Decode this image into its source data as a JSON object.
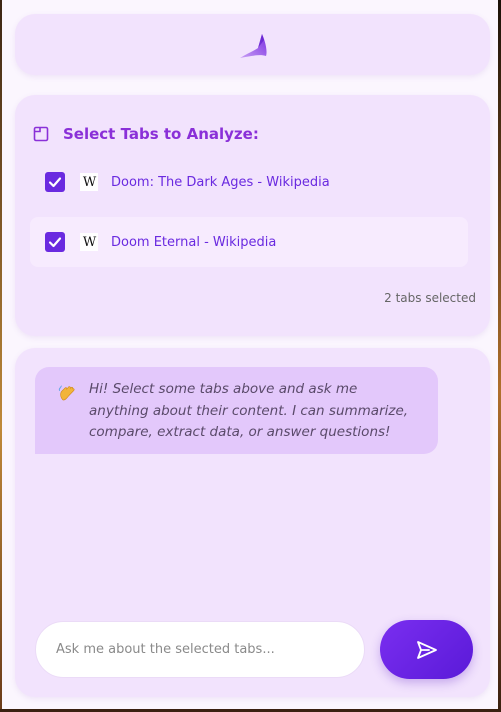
{
  "header": {
    "logo_icon": "megaphone-horn-icon"
  },
  "tabs_panel": {
    "title": "Select Tabs to Analyze:",
    "title_icon": "tab-icon",
    "tabs": [
      {
        "checked": true,
        "favicon": "W",
        "title": "Doom: The Dark Ages - Wikipedia"
      },
      {
        "checked": true,
        "favicon": "W",
        "title": "Doom Eternal - Wikipedia"
      }
    ],
    "selected_count_text": "2 tabs selected"
  },
  "chat": {
    "greeting_icon": "waving-hand-icon",
    "greeting": "Hi! Select some tabs above and ask me anything about their content. I can summarize, compare, extract data, or answer questions!",
    "input_placeholder": "Ask me about the selected tabs...",
    "input_value": "",
    "send_icon": "send-icon"
  },
  "colors": {
    "accent": "#6a2ae0",
    "title": "#8a30d8",
    "card": "#f2e3fd",
    "bubble": "#e3c8fb"
  }
}
